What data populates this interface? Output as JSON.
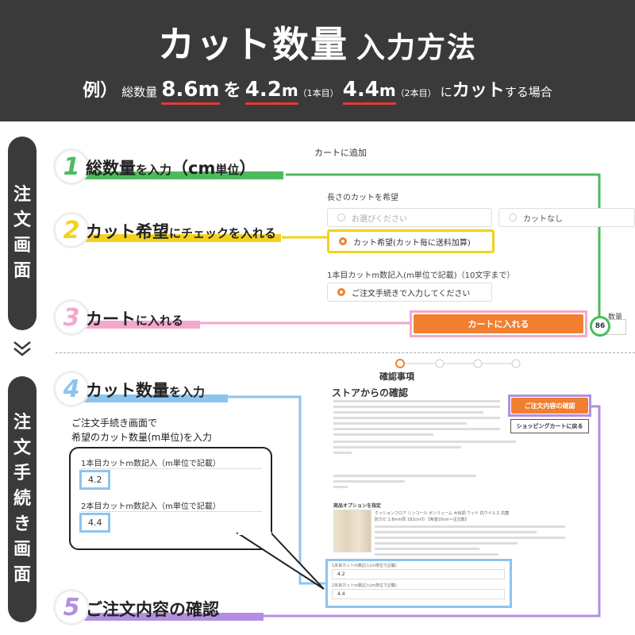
{
  "header": {
    "title_main": "カット数量",
    "title_sub": "入力方法",
    "example_prefix": "例）",
    "total_label": "総数量",
    "total_value": "8.6m",
    "wo": "を",
    "cut1_value": "4.2",
    "cut1_unit": "m",
    "cut1_note": "（1本目）",
    "cut2_value": "4.4",
    "cut2_unit": "m",
    "cut2_note": "（2本目）",
    "ni": "に",
    "cut_word": "カット",
    "suffix": "する場合"
  },
  "side": {
    "order_screen": [
      "注",
      "文",
      "画",
      "面"
    ],
    "checkout_screen": [
      "注",
      "文",
      "手",
      "続",
      "き",
      "画",
      "面"
    ]
  },
  "steps": [
    {
      "num": "1",
      "bold1": "総数量",
      "small1": "を入力",
      "bold2": "（cm",
      "small2": "単位",
      "bold3": "）"
    },
    {
      "num": "2",
      "bold1": "カット希望",
      "small1": "にチェックを入れる"
    },
    {
      "num": "3",
      "bold1": "カート",
      "small1": "に入れる"
    },
    {
      "num": "4",
      "bold1": "カット数量",
      "small1": "を入力"
    },
    {
      "num": "5",
      "bold1": "ご注文内容の確認"
    }
  ],
  "cart": {
    "title": "カートに追加",
    "cut_label": "長さのカットを希望",
    "opt_placeholder": "お選びください",
    "opt_no_cut": "カットなし",
    "opt_cut": "カット希望(カット毎に送料加算)",
    "first_cut_label": "1本目カットm数記入(m単位で記載)（10文字まで）",
    "first_cut_placeholder": "ご注文手続きで入力してください",
    "add_button": "カートに入れる",
    "qty_label": "数量",
    "qty_value": "86"
  },
  "checkout": {
    "note_line1": "ご注文手続き画面で",
    "note_line2": "希望のカット数量(m単位)を入力",
    "field1_label": "1本目カットm数記入（m単位で記載）",
    "field1_value": "4.2",
    "field2_label": "2本目カットm数記入（m単位で記載）",
    "field2_value": "4.4",
    "confirm_title": "確認事項",
    "store_confirm": "ストアからの確認",
    "confirm_button": "ご注文内容の確認",
    "back_button": "ショッピングカートに戻る",
    "mini_field1_label": "1本目カットm数記入(m単位で記載)",
    "mini_field1_value": "4.2",
    "mini_field2_label": "2本目カットm数記入(m単位で記載)",
    "mini_field2_value": "4.4",
    "options_title": "商品オプションを指定",
    "product_name": "クッションフロア シンコール ボンリューム 木目調 ウッド 抗ウイルス 抗菌",
    "product_size": "防カビ 1.8mm厚 182cm巾 【希望10cm〜注文数】"
  },
  "colors": {
    "step1": "#4cbb5c",
    "step2": "#f2d21c",
    "step3": "#f2a8cc",
    "step4": "#8cc4f0",
    "step5": "#b48ee0",
    "accent": "#f08030",
    "header_bg": "#3a3a3a"
  },
  "icons": [
    "chevron-down-icon",
    "radio-icon"
  ]
}
